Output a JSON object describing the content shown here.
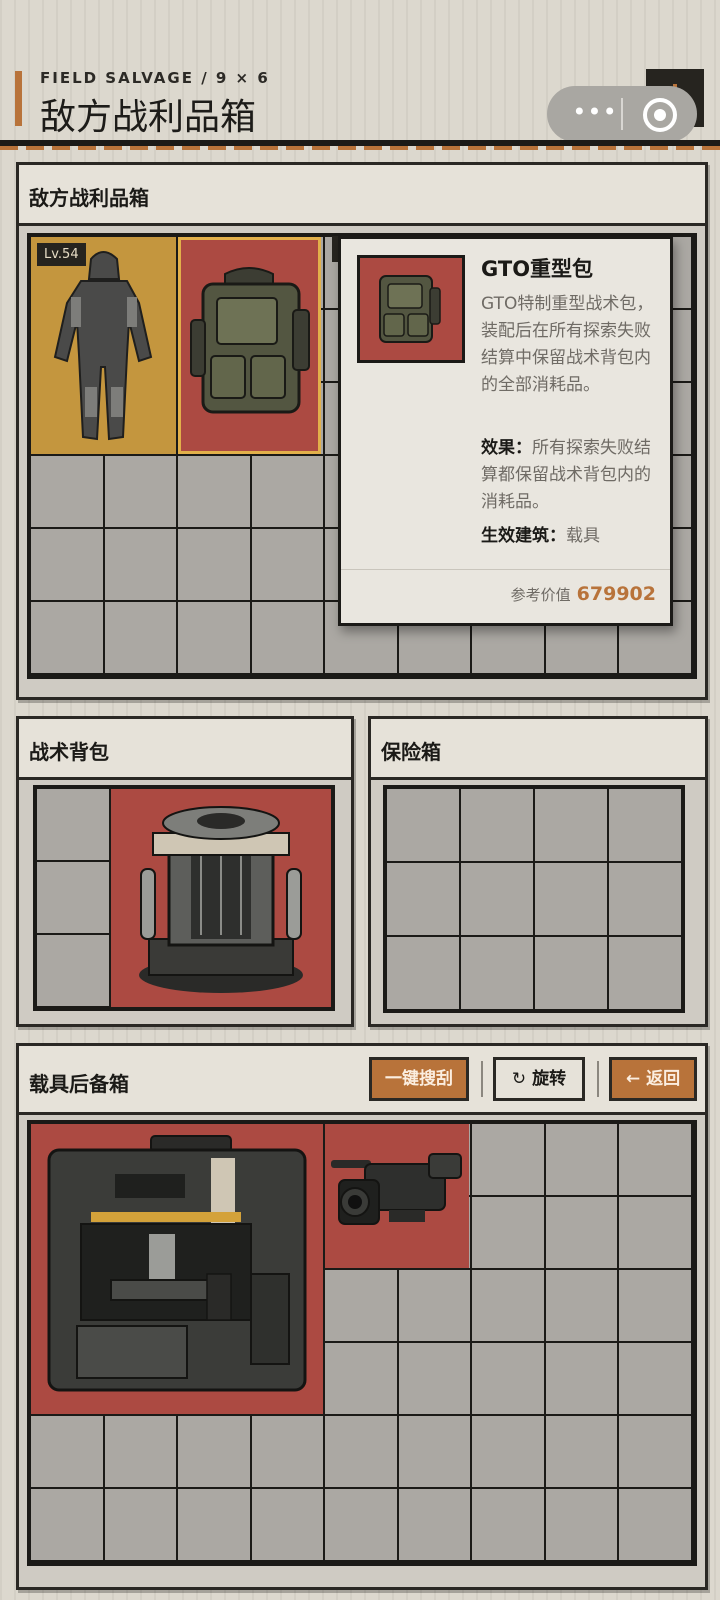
{
  "header": {
    "subtitle": "FIELD SALVAGE / 9 × 6",
    "title": "敌方战利品箱",
    "menu_dots": "•••"
  },
  "loot_panel": {
    "title": "敌方战利品箱",
    "items": [
      {
        "name": "suit",
        "level": "Lv.54"
      },
      {
        "name": "GTO重型包"
      }
    ]
  },
  "tooltip": {
    "name": "GTO重型包",
    "description": "GTO特制重型战术包，装配后在所有探索失败结算中保留战术背包内的全部消耗品。",
    "effect_label": "效果：",
    "effect_text": "所有探索失败结算都保留战术背包内的消耗品。",
    "building_label": "生效建筑：",
    "building_text": "载具",
    "value_label": "参考价值",
    "value": "679902"
  },
  "backpack_panel": {
    "title": "战术背包"
  },
  "safe_panel": {
    "title": "保险箱"
  },
  "vehicle_panel": {
    "title": "载具后备箱",
    "buttons": {
      "search_all": "一键搜刮",
      "rotate": "旋转",
      "back": "返回"
    }
  },
  "colors": {
    "accent": "#b8733a",
    "item_red": "#ac4a42",
    "item_gold": "#c4963e",
    "cell": "#aba8a3"
  }
}
